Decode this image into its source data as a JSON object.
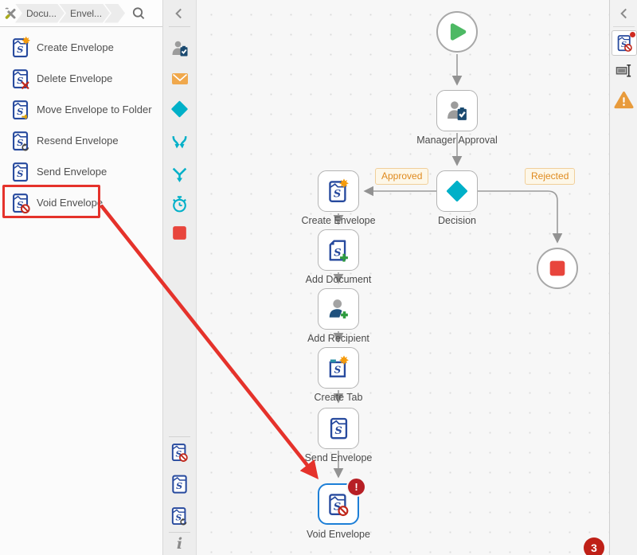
{
  "breadcrumb": {
    "crumbs": [
      {
        "label": "Docu..."
      },
      {
        "label": "Envel..."
      }
    ],
    "tools_icon": "wrench-screwdriver",
    "search_icon": "magnifier"
  },
  "sidebar": {
    "items": [
      {
        "label": "Create Envelope",
        "icon": "envelope-create-icon"
      },
      {
        "label": "Delete Envelope",
        "icon": "envelope-delete-icon"
      },
      {
        "label": "Move Envelope to Folder",
        "icon": "envelope-move-icon"
      },
      {
        "label": "Resend Envelope",
        "icon": "envelope-resend-icon"
      },
      {
        "label": "Send Envelope",
        "icon": "envelope-send-icon"
      },
      {
        "label": "Void Envelope",
        "icon": "envelope-void-icon",
        "highlighted": true
      }
    ]
  },
  "toolbox": {
    "icons": [
      "user-task-icon",
      "mail-icon",
      "decision-icon",
      "split-icon",
      "merge-icon",
      "timer-icon",
      "end-icon"
    ],
    "recent_icons": [
      "void-envelope-icon",
      "send-envelope-icon",
      "resend-envelope-icon"
    ],
    "info_label": "i"
  },
  "canvas": {
    "node_labels": {
      "manager_approval": "Manager Approval",
      "decision": "Decision",
      "create_envelope": "Create Envelope",
      "add_document": "Add Document",
      "add_recipient": "Add Recipient",
      "create_tab": "Create Tab",
      "send_envelope": "Send Envelope",
      "void_envelope": "Void Envelope"
    },
    "edge_labels": {
      "approved": "Approved",
      "rejected": "Rejected"
    },
    "error_badge": "!",
    "notification_count": "3"
  },
  "right_rail": {
    "icons": [
      "void-envelope-selected-icon",
      "rename-icon",
      "warning-icon"
    ]
  },
  "colors": {
    "accent_teal": "#00b0c8",
    "selected_blue": "#1d7fd7",
    "error_red": "#b71f25",
    "annotation_red": "#e5322b",
    "end_red": "#e8453c",
    "start_green": "#4db964",
    "mail_orange": "#f0a84c",
    "edge_label_orange": "#df8a1e",
    "warning_orange": "#e89b3c",
    "icon_blue": "#274a9e",
    "notification_red": "#bf2017"
  }
}
